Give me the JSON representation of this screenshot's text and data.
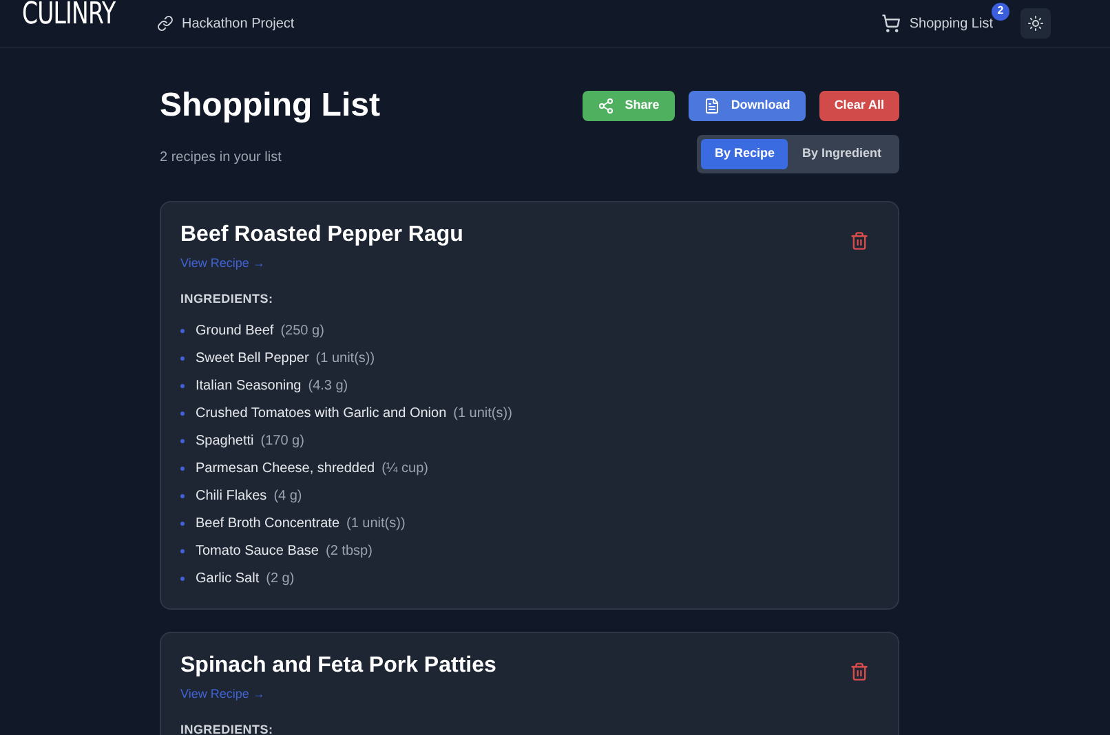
{
  "header": {
    "logo_left": "CULIN",
    "logo_right": "RY",
    "project_link": "Hackathon Project",
    "cart_label": "Shopping List",
    "cart_count": "2"
  },
  "page": {
    "title": "Shopping List",
    "subtitle": "2 recipes in your list",
    "actions": [
      {
        "label": "Share",
        "kind": "share"
      },
      {
        "label": "Download",
        "kind": "download"
      },
      {
        "label": "Clear All",
        "kind": "clear"
      }
    ],
    "views": [
      {
        "label": "By Recipe",
        "selected": true
      },
      {
        "label": "By Ingredient",
        "selected": false
      }
    ]
  },
  "recipes": [
    {
      "title": "Beef Roasted Pepper Ragu",
      "link": "View Recipe →",
      "ingredients_heading": "INGREDIENTS:",
      "ingredients": [
        {
          "name": "Ground Beef",
          "qty": "(250 g)"
        },
        {
          "name": "Sweet Bell Pepper",
          "qty": "(1 unit(s))"
        },
        {
          "name": "Italian Seasoning",
          "qty": "(4.3 g)"
        },
        {
          "name": "Crushed Tomatoes with Garlic and Onion",
          "qty": "(1 unit(s))"
        },
        {
          "name": "Spaghetti",
          "qty": "(170 g)"
        },
        {
          "name": "Parmesan Cheese, shredded",
          "qty": "(¼ cup)"
        },
        {
          "name": "Chili Flakes",
          "qty": "(4 g)"
        },
        {
          "name": "Beef Broth Concentrate",
          "qty": "(1 unit(s))"
        },
        {
          "name": "Tomato Sauce Base",
          "qty": "(2 tbsp)"
        },
        {
          "name": "Garlic Salt",
          "qty": "(2 g)"
        }
      ]
    },
    {
      "title": "Spinach and Feta Pork Patties",
      "link": "View Recipe →",
      "ingredients_heading": "INGREDIENTS:"
    }
  ]
}
